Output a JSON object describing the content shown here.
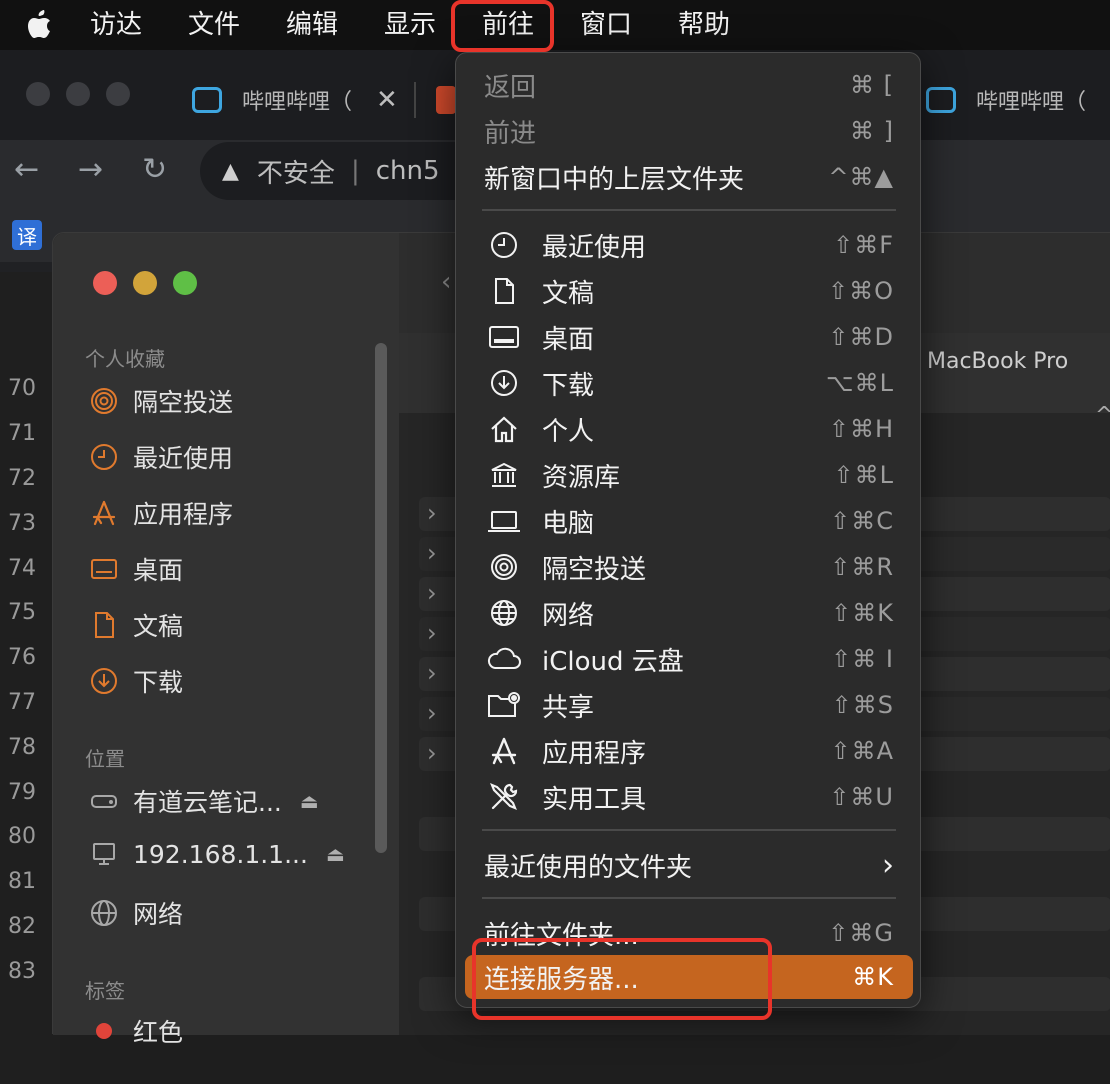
{
  "menubar": {
    "items": [
      "访达",
      "文件",
      "编辑",
      "显示",
      "前往",
      "窗口",
      "帮助"
    ]
  },
  "browser": {
    "tabs": [
      {
        "title": "哔哩哔哩（"
      },
      {
        "title": "哔哩哔哩（"
      }
    ],
    "security_label": "不安全",
    "url": "chn5",
    "bookmark_first": "译"
  },
  "code_lines": [
    "70",
    "71",
    "72",
    "73",
    "74",
    "75",
    "76",
    "77",
    "78",
    "79",
    "80",
    "81",
    "82",
    "83"
  ],
  "finder": {
    "device_label": "MacBook Pro",
    "sidebar": {
      "favorites_header": "个人收藏",
      "favorites": [
        "隔空投送",
        "最近使用",
        "应用程序",
        "桌面",
        "文稿",
        "下载"
      ],
      "locations_header": "位置",
      "locations": [
        "有道云笔记...",
        "192.168.1.1...",
        "网络"
      ],
      "tags_header": "标签",
      "tags": [
        "红色"
      ]
    }
  },
  "go_menu": {
    "back": {
      "label": "返回",
      "shortcut": "⌘ ["
    },
    "forward": {
      "label": "前进",
      "shortcut": "⌘ ]"
    },
    "enclosing": {
      "label": "新窗口中的上层文件夹",
      "shortcut": "^⌘▲"
    },
    "places": [
      {
        "label": "最近使用",
        "shortcut": "⇧⌘F",
        "icon": "clock-icon"
      },
      {
        "label": "文稿",
        "shortcut": "⇧⌘O",
        "icon": "document-icon"
      },
      {
        "label": "桌面",
        "shortcut": "⇧⌘D",
        "icon": "desktop-icon"
      },
      {
        "label": "下载",
        "shortcut": "⌥⌘L",
        "icon": "download-icon"
      },
      {
        "label": "个人",
        "shortcut": "⇧⌘H",
        "icon": "home-icon"
      },
      {
        "label": "资源库",
        "shortcut": "⇧⌘L",
        "icon": "library-icon"
      },
      {
        "label": "电脑",
        "shortcut": "⇧⌘C",
        "icon": "laptop-icon"
      },
      {
        "label": "隔空投送",
        "shortcut": "⇧⌘R",
        "icon": "airdrop-icon"
      },
      {
        "label": "网络",
        "shortcut": "⇧⌘K",
        "icon": "globe-icon"
      },
      {
        "label": "iCloud 云盘",
        "shortcut": "⇧⌘ I",
        "icon": "cloud-icon"
      },
      {
        "label": "共享",
        "shortcut": "⇧⌘S",
        "icon": "shared-folder-icon"
      },
      {
        "label": "应用程序",
        "shortcut": "⇧⌘A",
        "icon": "applications-icon"
      },
      {
        "label": "实用工具",
        "shortcut": "⇧⌘U",
        "icon": "utilities-icon"
      }
    ],
    "recent_folders": {
      "label": "最近使用的文件夹"
    },
    "go_to_folder": {
      "label": "前往文件夹...",
      "shortcut": "⇧⌘G"
    },
    "connect_server": {
      "label": "连接服务器...",
      "shortcut": "⌘K"
    }
  },
  "colors": {
    "accent": "#c5651f",
    "annotation": "#e8342a"
  }
}
